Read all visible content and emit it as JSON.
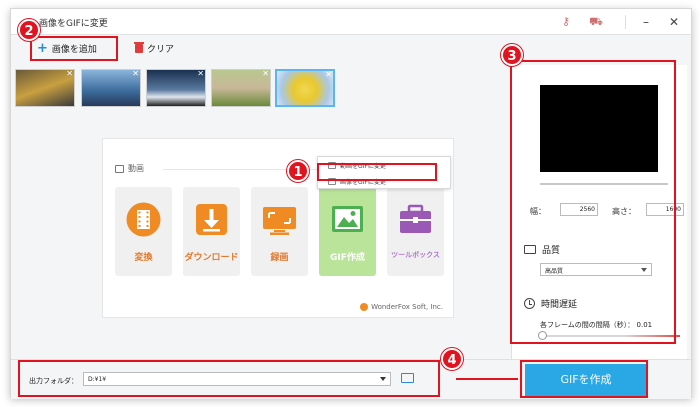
{
  "window": {
    "title": "画像をGIFに変更",
    "controls": [
      "minimize-icon",
      "close-icon"
    ]
  },
  "toolbar": {
    "add_label": "画像を追加",
    "clear_label": "クリア"
  },
  "thumbnails": [
    {
      "name": "yellow sports car",
      "color": "#a08830",
      "selected": false
    },
    {
      "name": "blue bottle landscape",
      "color": "#4f7ab0",
      "selected": false
    },
    {
      "name": "white car night",
      "color": "#3a5a82",
      "selected": false
    },
    {
      "name": "bunny on grass",
      "color": "#9fb070",
      "selected": false
    },
    {
      "name": "minion",
      "color": "#e8d860",
      "selected": true
    }
  ],
  "card": {
    "section_label": "動画",
    "tiles": [
      {
        "label": "変換",
        "icon": "film-convert-icon",
        "color": "#f08a22"
      },
      {
        "label": "ダウンロード",
        "icon": "download-icon",
        "color": "#f08a22"
      },
      {
        "label": "録画",
        "icon": "monitor-record-icon",
        "color": "#f08a22"
      },
      {
        "label": "GIF作成",
        "icon": "image-gif-icon",
        "color": "#4caf50"
      },
      {
        "label": "ツールボックス",
        "icon": "toolbox-icon",
        "color": "#9b59b6"
      }
    ],
    "brand": "WonderFox Soft, Inc."
  },
  "gif_menu": {
    "items": [
      "動画をGIFに変更",
      "画像をGIFに変更"
    ]
  },
  "settings": {
    "width_label": "幅：",
    "width_value": "2560",
    "height_label": "高さ：",
    "height_value": "1600",
    "quality_label": "品質",
    "quality_value": "高品質",
    "delay_label": "時間遅延",
    "delay_desc": "各フレームの間の間隔（秒）：",
    "delay_value": "0.01",
    "delay_slider_fraction": 0.0
  },
  "bottom": {
    "output_label": "出力フォルダ：",
    "output_path": "D:¥1¥",
    "create_label": "GIFを作成"
  },
  "annotations": {
    "badge1": "1",
    "badge2": "2",
    "badge3": "3",
    "badge4": "4",
    "color": "#e0131f"
  }
}
